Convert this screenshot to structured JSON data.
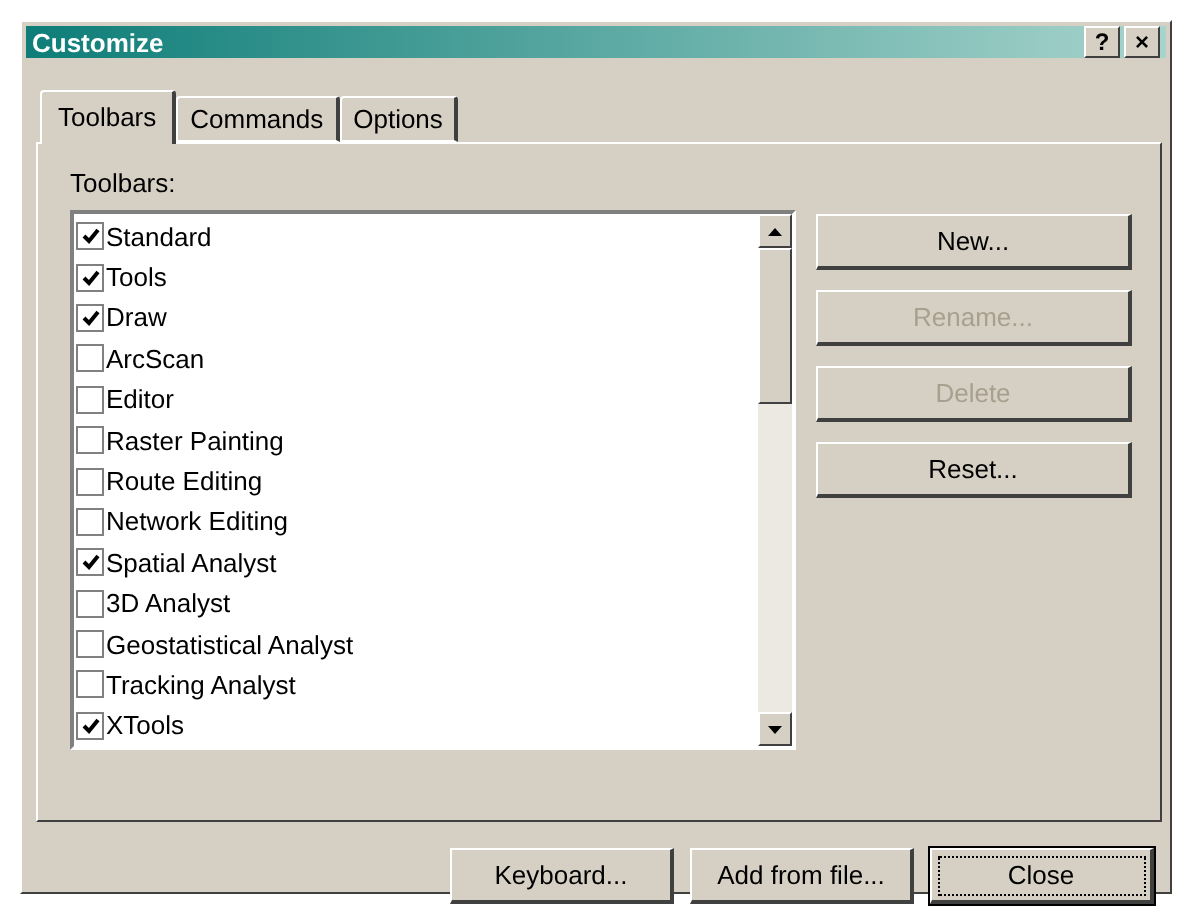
{
  "window": {
    "title": "Customize",
    "help_button": "?",
    "close_button": "×"
  },
  "tabs": [
    {
      "label": "Toolbars",
      "selected": true
    },
    {
      "label": "Commands",
      "selected": false
    },
    {
      "label": "Options",
      "selected": false
    }
  ],
  "toolbars_label": "Toolbars:",
  "toolbars": [
    {
      "name": "Standard",
      "checked": true
    },
    {
      "name": "Tools",
      "checked": true
    },
    {
      "name": "Draw",
      "checked": true
    },
    {
      "name": "ArcScan",
      "checked": false
    },
    {
      "name": "Editor",
      "checked": false
    },
    {
      "name": "Raster Painting",
      "checked": false
    },
    {
      "name": "Route Editing",
      "checked": false
    },
    {
      "name": "Network Editing",
      "checked": false
    },
    {
      "name": "Spatial Analyst",
      "checked": true
    },
    {
      "name": "3D Analyst",
      "checked": false
    },
    {
      "name": "Geostatistical Analyst",
      "checked": false
    },
    {
      "name": "Tracking Analyst",
      "checked": false
    },
    {
      "name": "XTools",
      "checked": true
    }
  ],
  "side_buttons": [
    {
      "label": "New...",
      "disabled": false
    },
    {
      "label": "Rename...",
      "disabled": true
    },
    {
      "label": "Delete",
      "disabled": true
    },
    {
      "label": "Reset...",
      "disabled": false
    }
  ],
  "bottom_buttons": [
    {
      "label": "Keyboard...",
      "focused": false
    },
    {
      "label": "Add from file...",
      "focused": false
    },
    {
      "label": "Close",
      "focused": true
    }
  ]
}
